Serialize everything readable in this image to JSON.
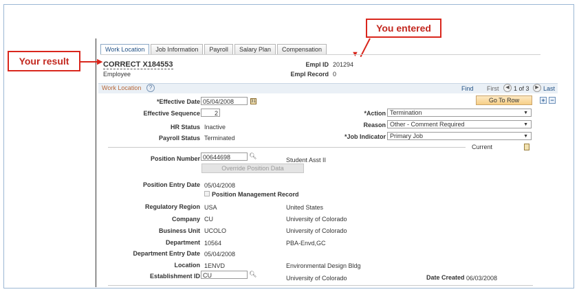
{
  "callouts": {
    "you_entered": "You entered",
    "your_result": "Your result"
  },
  "tabs": [
    {
      "label": "Work Location",
      "active": true
    },
    {
      "label": "Job Information",
      "active": false
    },
    {
      "label": "Payroll",
      "active": false
    },
    {
      "label": "Salary Plan",
      "active": false
    },
    {
      "label": "Compensation",
      "active": false
    }
  ],
  "employee": {
    "name": "CORRECT X184553",
    "subtitle": "Employee",
    "empl_id_label": "Empl ID",
    "empl_id": "201294",
    "empl_record_label": "Empl Record",
    "empl_record": "0"
  },
  "section": {
    "title": "Work Location",
    "help_icon": "?",
    "find": "Find",
    "first": "First",
    "paging": "1 of 3",
    "last": "Last"
  },
  "form": {
    "effective_date_label": "*Effective Date",
    "effective_date": "05/04/2008",
    "effective_sequence_label": "Effective Sequence",
    "effective_sequence": "2",
    "hr_status_label": "HR Status",
    "hr_status": "Inactive",
    "payroll_status_label": "Payroll Status",
    "payroll_status": "Terminated",
    "go_to_row": "Go To Row",
    "action_label": "*Action",
    "action": "Termination",
    "reason_label": "Reason",
    "reason": "Other - Comment Required",
    "job_indicator_label": "*Job Indicator",
    "job_indicator": "Primary Job",
    "current": "Current",
    "position_number_label": "Position Number",
    "position_number": "00644698",
    "position_desc": "Student Asst II",
    "override_button": "Override Position Data",
    "position_entry_date_label": "Position Entry Date",
    "position_entry_date": "05/04/2008",
    "position_mgmt_label": "Position Management Record",
    "regulatory_region_label": "Regulatory Region",
    "regulatory_region": "USA",
    "regulatory_region_desc": "United States",
    "company_label": "Company",
    "company": "CU",
    "company_desc": "University of Colorado",
    "business_unit_label": "Business Unit",
    "business_unit": "UCOLO",
    "business_unit_desc": "University of Colorado",
    "department_label": "Department",
    "department": "10564",
    "department_desc": "PBA-Envd,GC",
    "department_entry_date_label": "Department Entry Date",
    "department_entry_date": "05/04/2008",
    "location_label": "Location",
    "location": "1ENVD",
    "location_desc": "Environmental Design Bldg",
    "establishment_id_label": "Establishment ID",
    "establishment_id": "CU",
    "establishment_desc": "University of Colorado",
    "date_created_label": "Date Created",
    "date_created": "06/03/2008"
  },
  "colors": {
    "callout_red": "#d9261c",
    "link_blue": "#1f4f84",
    "section_title": "#b7683a"
  }
}
